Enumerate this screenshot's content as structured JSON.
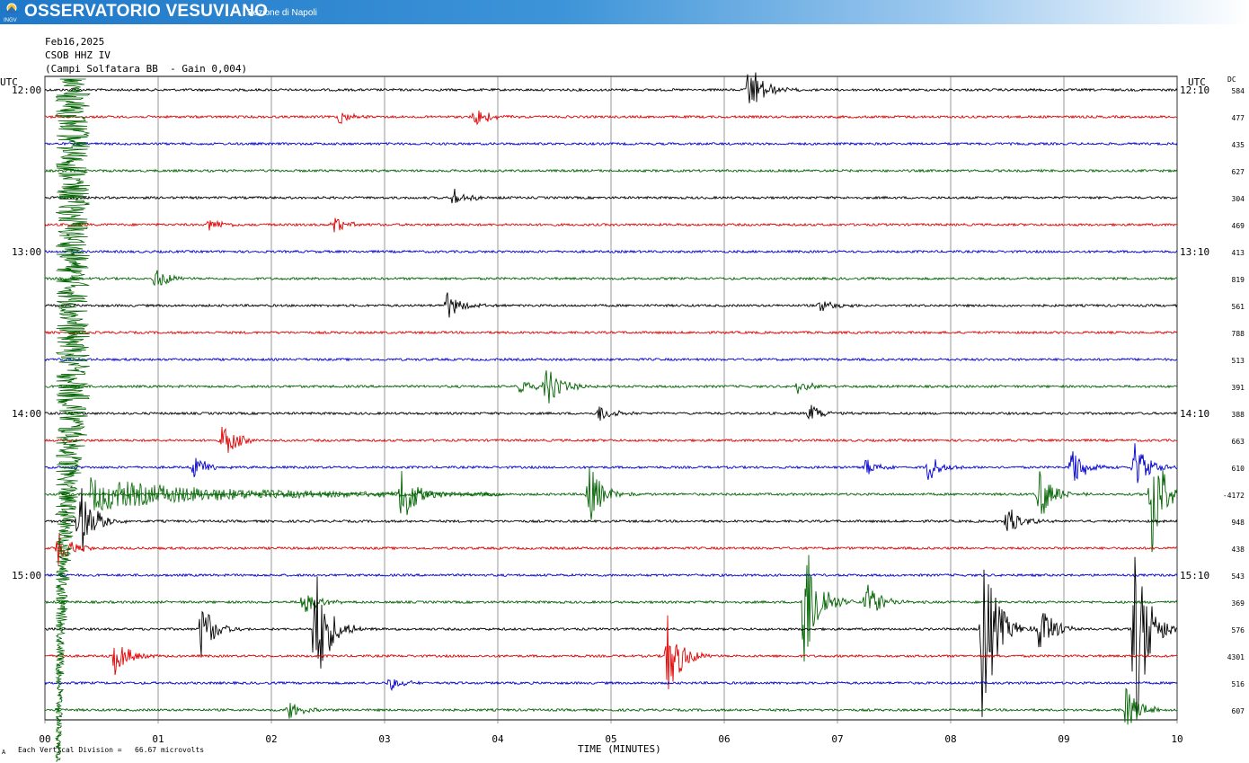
{
  "banner": {
    "logo_text": "INGV",
    "title": "OSSERVATORIO VESUVIANO",
    "subtitle": "Sezione di Napoli",
    "color": "#1f78c8"
  },
  "header": {
    "date": "Feb16,2025",
    "station": "CSOB HHZ IV",
    "location_gain": "(Campi Solfatara BB  - Gain 0,004)"
  },
  "axis": {
    "left_unit": "UTC",
    "right_unit": "UTC",
    "dc_label": "DC",
    "footer_note": "Each Vertical Division =   66.67 microvolts",
    "footer_mark": "A"
  },
  "chart_data": {
    "type": "line",
    "title": "",
    "xlabel": "TIME (MINUTES)",
    "x_ticks": [
      "00",
      "01",
      "02",
      "03",
      "04",
      "05",
      "06",
      "07",
      "08",
      "09",
      "10"
    ],
    "xlim": [
      0,
      10
    ],
    "grid": true,
    "trace_colors": [
      "#000000",
      "#e00000",
      "#0000d0",
      "#006400"
    ],
    "left_time_labels": [
      {
        "trace": 0,
        "label": "12:00"
      },
      {
        "trace": 6,
        "label": "13:00"
      },
      {
        "trace": 12,
        "label": "14:00"
      },
      {
        "trace": 18,
        "label": "15:00"
      }
    ],
    "right_time_labels": [
      {
        "trace": 0,
        "label": "12:10"
      },
      {
        "trace": 6,
        "label": "13:10"
      },
      {
        "trace": 12,
        "label": "14:10"
      },
      {
        "trace": 18,
        "label": "15:10"
      }
    ],
    "dc_offsets": [
      "584",
      "477",
      "435",
      "627",
      "304",
      "469",
      "413",
      "819",
      "561",
      "788",
      "513",
      "391",
      "388",
      "663",
      "610",
      "-4172",
      "948",
      "438",
      "543",
      "369",
      "576",
      "4301",
      "516",
      "607"
    ],
    "minutes_per_trace": 10,
    "events": [
      {
        "trace": 0,
        "minute": 6.22,
        "amplitude": 1.2
      },
      {
        "trace": 1,
        "minute": 3.8,
        "amplitude": 0.5
      },
      {
        "trace": 1,
        "minute": 2.6,
        "amplitude": 0.3
      },
      {
        "trace": 4,
        "minute": 3.6,
        "amplitude": 0.4
      },
      {
        "trace": 5,
        "minute": 2.55,
        "amplitude": 0.35
      },
      {
        "trace": 5,
        "minute": 1.45,
        "amplitude": 0.3
      },
      {
        "trace": 7,
        "minute": 0.98,
        "amplitude": 0.5
      },
      {
        "trace": 8,
        "minute": 3.55,
        "amplitude": 0.6
      },
      {
        "trace": 8,
        "minute": 6.85,
        "amplitude": 0.3
      },
      {
        "trace": 11,
        "minute": 4.42,
        "amplitude": 1.0
      },
      {
        "trace": 11,
        "minute": 4.2,
        "amplitude": 0.4
      },
      {
        "trace": 11,
        "minute": 6.65,
        "amplitude": 0.3
      },
      {
        "trace": 12,
        "minute": 4.9,
        "amplitude": 0.4
      },
      {
        "trace": 12,
        "minute": 6.75,
        "amplitude": 0.4
      },
      {
        "trace": 13,
        "minute": 1.57,
        "amplitude": 0.8
      },
      {
        "trace": 14,
        "minute": 1.32,
        "amplitude": 0.5
      },
      {
        "trace": 14,
        "minute": 7.25,
        "amplitude": 0.4
      },
      {
        "trace": 14,
        "minute": 7.8,
        "amplitude": 0.6
      },
      {
        "trace": 14,
        "minute": 9.07,
        "amplitude": 0.9
      },
      {
        "trace": 14,
        "minute": 9.62,
        "amplitude": 1.1
      },
      {
        "trace": 15,
        "minute": 3.15,
        "amplitude": 1.6
      },
      {
        "trace": 15,
        "minute": 4.8,
        "amplitude": 1.4
      },
      {
        "trace": 15,
        "minute": 8.78,
        "amplitude": 1.2
      },
      {
        "trace": 15,
        "minute": 9.77,
        "amplitude": 3.0
      },
      {
        "trace": 16,
        "minute": 0.3,
        "amplitude": 1.8
      },
      {
        "trace": 16,
        "minute": 8.5,
        "amplitude": 0.7
      },
      {
        "trace": 17,
        "minute": 0.12,
        "amplitude": 0.8
      },
      {
        "trace": 19,
        "minute": 6.7,
        "amplitude": 3.5
      },
      {
        "trace": 19,
        "minute": 7.25,
        "amplitude": 1.0
      },
      {
        "trace": 19,
        "minute": 2.28,
        "amplitude": 0.6
      },
      {
        "trace": 20,
        "minute": 2.38,
        "amplitude": 3.0
      },
      {
        "trace": 20,
        "minute": 1.38,
        "amplitude": 1.2
      },
      {
        "trace": 20,
        "minute": 8.28,
        "amplitude": 4.0
      },
      {
        "trace": 20,
        "minute": 8.78,
        "amplitude": 1.2
      },
      {
        "trace": 20,
        "minute": 9.62,
        "amplitude": 4.5
      },
      {
        "trace": 21,
        "minute": 5.5,
        "amplitude": 1.8
      },
      {
        "trace": 21,
        "minute": 0.62,
        "amplitude": 0.8
      },
      {
        "trace": 22,
        "minute": 3.05,
        "amplitude": 0.3
      },
      {
        "trace": 23,
        "minute": 9.55,
        "amplitude": 1.0
      },
      {
        "trace": 23,
        "minute": 2.15,
        "amplitude": 0.4
      }
    ]
  }
}
